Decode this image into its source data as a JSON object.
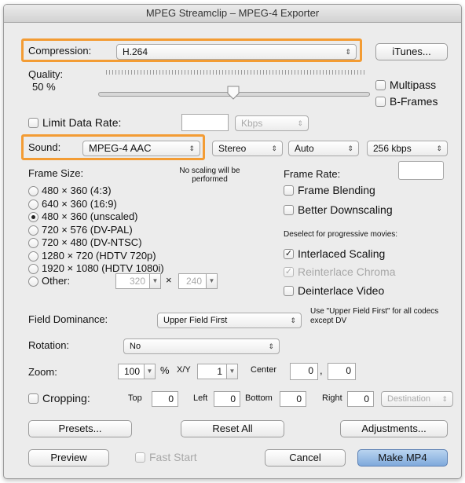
{
  "window": {
    "title": "MPEG Streamclip – MPEG-4 Exporter"
  },
  "compression": {
    "label": "Compression:",
    "value": "H.264",
    "itunes_button": "iTunes..."
  },
  "quality": {
    "label": "Quality:",
    "percent": "50 %",
    "slider_value": 0.5
  },
  "multipass": {
    "label": "Multipass",
    "checked": false
  },
  "bframes": {
    "label": "B-Frames",
    "checked": false
  },
  "limit_data_rate": {
    "label": "Limit Data Rate:",
    "value": "",
    "unit": "Kbps"
  },
  "sound": {
    "label": "Sound:",
    "codec": "MPEG-4 AAC",
    "channels": "Stereo",
    "rate": "Auto",
    "bitrate": "256 kbps"
  },
  "frame_size": {
    "label": "Frame Size:",
    "note": "No scaling will be performed",
    "options": [
      {
        "label": "480 × 360  (4:3)",
        "selected": false
      },
      {
        "label": "640 × 360  (16:9)",
        "selected": false
      },
      {
        "label": "480 × 360  (unscaled)",
        "selected": true
      },
      {
        "label": "720 × 576  (DV-PAL)",
        "selected": false
      },
      {
        "label": "720 × 480  (DV-NTSC)",
        "selected": false
      },
      {
        "label": "1280 × 720  (HDTV 720p)",
        "selected": false
      },
      {
        "label": "1920 × 1080  (HDTV 1080i)",
        "selected": false
      }
    ],
    "other_label": "Other:",
    "other_width": "320",
    "other_times": "×",
    "other_height": "240"
  },
  "frame_rate": {
    "label": "Frame Rate:",
    "value": ""
  },
  "frame_blending": {
    "label": "Frame Blending",
    "checked": false
  },
  "better_downscaling": {
    "label": "Better Downscaling",
    "checked": false
  },
  "deselect_note": "Deselect for progressive movies:",
  "interlaced_scaling": {
    "label": "Interlaced Scaling",
    "checked": true
  },
  "reinterlace_chroma": {
    "label": "Reinterlace Chroma",
    "checked": true,
    "disabled": true
  },
  "deinterlace_video": {
    "label": "Deinterlace Video",
    "checked": false
  },
  "field_dominance": {
    "label": "Field Dominance:",
    "value": "Upper Field First",
    "note": "Use \"Upper Field First\" for all codecs except DV"
  },
  "rotation": {
    "label": "Rotation:",
    "value": "No"
  },
  "zoom": {
    "label": "Zoom:",
    "value": "100",
    "percent_sign": "%",
    "xy_label": "X/Y",
    "xy_value": "1",
    "center_label": "Center",
    "center_x": "0",
    "comma": ",",
    "center_y": "0"
  },
  "cropping": {
    "label": "Cropping:",
    "checked": false,
    "top_label": "Top",
    "top": "0",
    "left_label": "Left",
    "left": "0",
    "bottom_label": "Bottom",
    "bottom": "0",
    "right_label": "Right",
    "right": "0",
    "destination": "Destination"
  },
  "buttons": {
    "presets": "Presets...",
    "reset_all": "Reset All",
    "adjustments": "Adjustments...",
    "preview": "Preview",
    "fast_start": "Fast Start",
    "cancel": "Cancel",
    "make": "Make MP4"
  },
  "colors": {
    "highlight": "#f39c34",
    "default_button": "#8fb4e3"
  }
}
